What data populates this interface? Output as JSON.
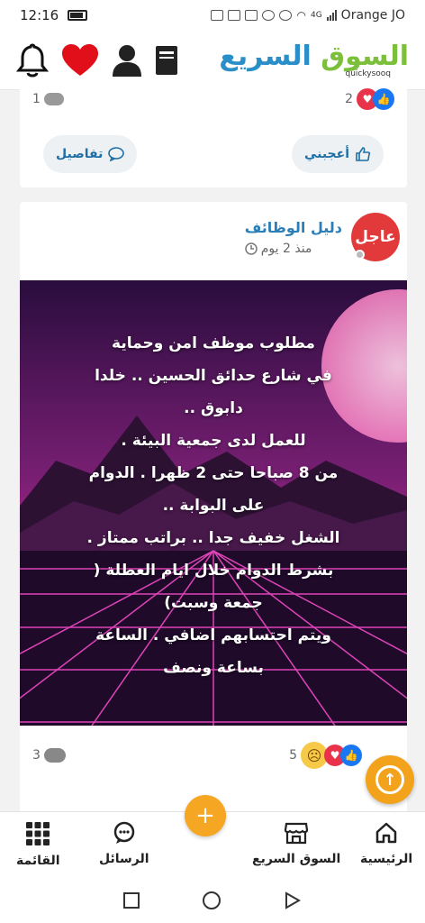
{
  "status": {
    "time": "12:16",
    "carrier": "Orange JO",
    "net": "4G"
  },
  "header": {
    "logo_ar_main": "السوق",
    "logo_ar_accent": "السريع",
    "logo_en": "quickysooq"
  },
  "card1": {
    "likes_count": "2",
    "comments_count": "1",
    "like_label": "أعجبني",
    "details_label": "تفاصيل"
  },
  "card2": {
    "poster_name": "دليل الوظائف",
    "posted_time": "منذ 2 يوم",
    "avatar_text": "عاجل",
    "post_lines": [
      "مطلوب موظف امن وحماية",
      "في شارع حدائق الحسين .. خلدا",
      "دابوق ..",
      "للعمل لدى جمعية البيئة .",
      "من 8 صباحا حتى 2 ظهرا . الدوام",
      "على البوابة ..",
      "الشغل خفيف جدا .. براتب ممتاز .",
      "بشرط الدوام خلال ايام العطلة (",
      "جمعة وسبت)",
      "ويتم احتسابهم اضافي . الساعة",
      "بساعة ونصف"
    ],
    "reactions_count": "5",
    "comments_count": "3"
  },
  "nav": {
    "home": "الرئيسية",
    "market": "السوق السريع",
    "messages": "الرسائل",
    "menu": "القائمة"
  },
  "colors": {
    "accent_blue": "#2a8fc8",
    "accent_green": "#7cbf3b",
    "orange": "#f5a623",
    "urgent_red": "#e23a3a"
  },
  "icons": [
    "bell-icon",
    "heart-icon",
    "user-icon",
    "book-icon",
    "thumbs-up-icon",
    "comment-icon",
    "clock-icon",
    "arrow-up-icon",
    "plus-icon",
    "home-icon",
    "store-icon",
    "chat-icon",
    "grid-icon"
  ]
}
